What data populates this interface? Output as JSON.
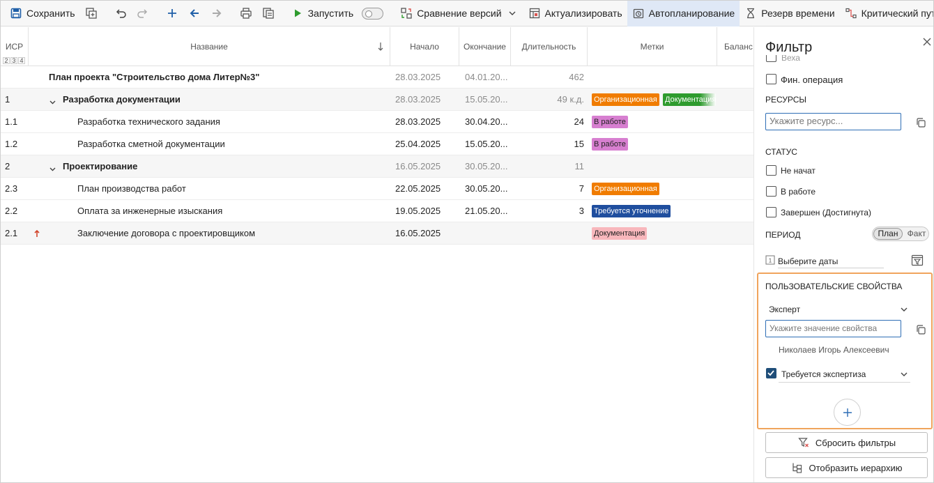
{
  "toolbar": {
    "save": "Сохранить",
    "run": "Запустить",
    "compare": "Сравнение версий",
    "actualize": "Актуализировать",
    "autoplan": "Автопланирование",
    "reserve": "Резерв времени",
    "critical": "Критический путь"
  },
  "columns": {
    "wbs": "ИСР",
    "name": "Название",
    "start": "Начало",
    "end": "Окончание",
    "duration": "Длительность",
    "tags": "Метки",
    "balance": "Баланс",
    "levels": [
      "2",
      "3",
      "4"
    ]
  },
  "rows": [
    {
      "wbs": "",
      "name": "План проекта \"Строительство дома Литер№3\"",
      "start": "28.03.2025",
      "end": "04.01.20...",
      "duration": "462"
    },
    {
      "wbs": "1",
      "name": "Разработка документации",
      "start": "28.03.2025",
      "end": "15.05.20...",
      "duration": "49 к.д.",
      "tag1": "Организационная",
      "tag2": "Документация"
    },
    {
      "wbs": "1.1",
      "name": "Разработка технического задания",
      "start": "28.03.2025",
      "end": "30.04.20...",
      "duration": "24",
      "tag1": "В работе"
    },
    {
      "wbs": "1.2",
      "name": "Разработка сметной документации",
      "start": "25.04.2025",
      "end": "15.05.20...",
      "duration": "15",
      "tag1": "В работе"
    },
    {
      "wbs": "2",
      "name": "Проектирование",
      "start": "16.05.2025",
      "end": "30.05.20...",
      "duration": "11"
    },
    {
      "wbs": "2.3",
      "name": "План производства работ",
      "start": "22.05.2025",
      "end": "30.05.20...",
      "duration": "7",
      "tag1": "Организационная"
    },
    {
      "wbs": "2.2",
      "name": "Оплата за инженерные изыскания",
      "start": "19.05.2025",
      "end": "21.05.20...",
      "duration": "3",
      "tag1": "Требуется уточнение"
    },
    {
      "wbs": "2.1",
      "name": "Заключение договора с проектировщиком",
      "start": "16.05.2025",
      "end": "",
      "duration": "",
      "tag1": "Документация"
    }
  ],
  "colors": {
    "org": "#f07c00",
    "doc": "#2e9b2e",
    "work": "#d77fd0",
    "clarify": "#1f4e9e",
    "doc_pink": "#f8b7bc",
    "highlight": "#f0a45c",
    "accent": "#2d6db5"
  },
  "filter": {
    "title": "Фильтр",
    "milestone": "Веха",
    "fin_op": "Фин. операция",
    "resources_title": "РЕСУРСЫ",
    "resource_placeholder": "Укажите ресурс...",
    "status_title": "СТАТУС",
    "status_not_started": "Не начат",
    "status_in_work": "В работе",
    "status_done": "Завершен (Достигнута)",
    "period_title": "ПЕРИОД",
    "period_plan": "План",
    "period_fact": "Факт",
    "dates_placeholder": "Выберите даты",
    "custom_title": "ПОЛЬЗОВАТЕЛЬСКИЕ СВОЙСТВА",
    "property1": "Эксперт",
    "property_placeholder": "Укажите значение свойства",
    "property_value": "Николаев Игорь Алексеевич",
    "property2": "Требуется экспертиза",
    "reset": "Сбросить фильтры",
    "hierarchy": "Отобразить иерархию"
  }
}
